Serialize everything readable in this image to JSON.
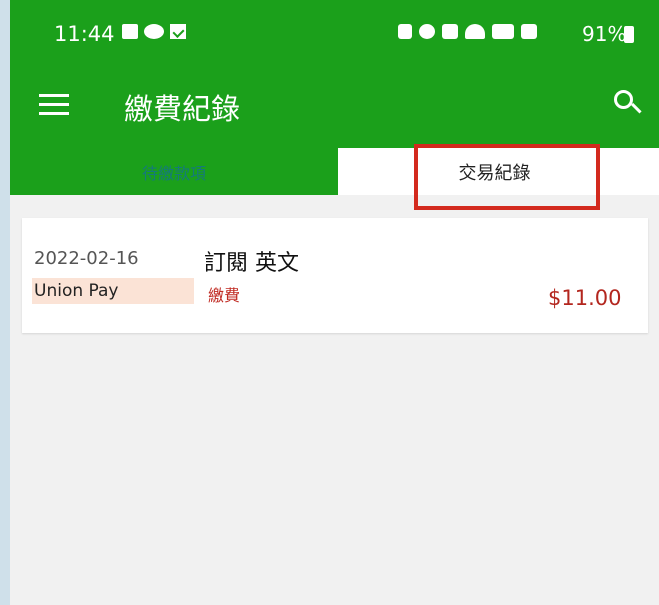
{
  "status_bar": {
    "time": "11:44",
    "battery": "91%"
  },
  "app_bar": {
    "title": "繳費紀錄",
    "menu_icon": "hamburger-menu-icon",
    "search_icon": "search-icon"
  },
  "tabs": [
    {
      "label": "待繳款項",
      "active": false
    },
    {
      "label": "交易紀錄",
      "active": true
    }
  ],
  "records": [
    {
      "date": "2022-02-16",
      "title": "訂閱 英文",
      "method": "Union Pay",
      "type": "繳費",
      "amount": "$11.00"
    }
  ],
  "colors": {
    "primary": "#1ba01b",
    "highlight": "#d32a1e",
    "amount": "#b3261e",
    "method_bg": "#fbe3d6"
  }
}
